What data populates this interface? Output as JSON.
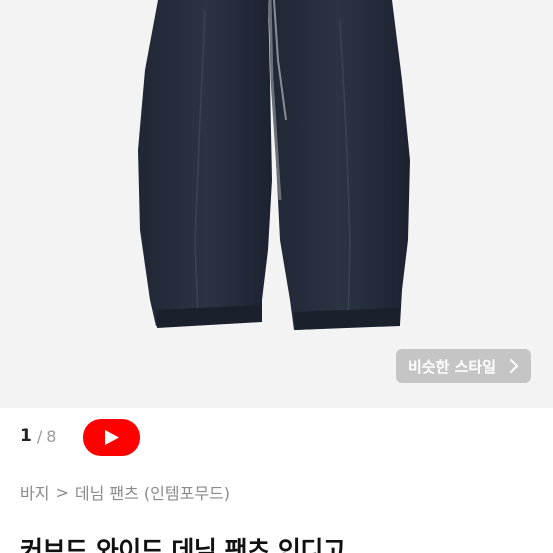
{
  "gallery": {
    "current_index": "1",
    "separator": "/",
    "total_count": "8",
    "similar_style_label": "비슷한 스타일"
  },
  "breadcrumb": {
    "category": "바지",
    "separator": ">",
    "subcategory": "데님 팬츠 (인템포무드)"
  },
  "product": {
    "title": "커브드 와이드 데님 팬츠 인디고"
  },
  "colors": {
    "video_button": "#ff0000",
    "denim": "#2a3140",
    "background": "#f3f3f3"
  },
  "icons": {
    "video": "play-triangle-icon",
    "similar_style": "chevron-right-icon"
  }
}
